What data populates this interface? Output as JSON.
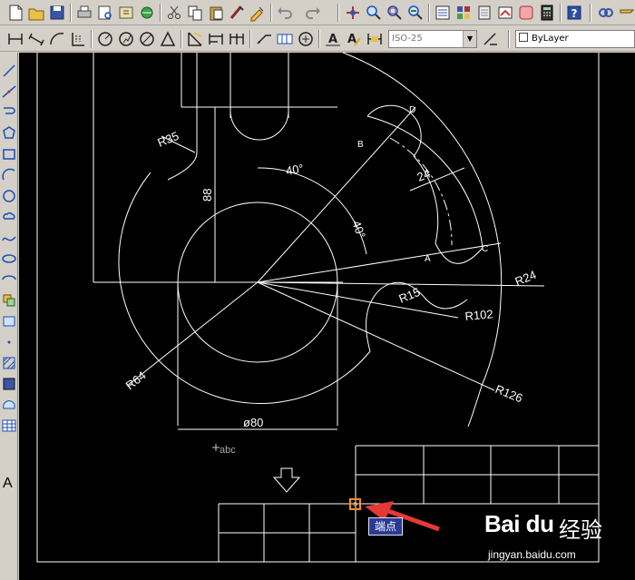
{
  "toolbar_standard": {
    "icons": [
      "new-file-icon",
      "open-file-icon",
      "save-icon",
      "print-icon",
      "print-preview-icon",
      "publish-icon",
      "plot-icon",
      "cut-icon",
      "copy-icon",
      "paste-icon",
      "match-properties-icon",
      "block-editor-icon",
      "undo-icon",
      "redo-icon",
      "pan-icon",
      "zoom-realtime-icon",
      "zoom-window-icon",
      "zoom-previous-icon",
      "properties-icon",
      "design-center-icon",
      "tool-palettes-icon",
      "markup-icon",
      "quick-calc-icon",
      "help-icon"
    ]
  },
  "toolbar_dimension": {
    "dimstyle_value": "ISO-25",
    "layer_value": "ByLayer"
  },
  "draw_toolbar": {
    "text_tool_label": "A"
  },
  "drawing": {
    "labels": {
      "r35": "R35",
      "r64": "R64",
      "r15": "R15",
      "r102": "R102",
      "r24": "R24",
      "r126": "R126",
      "dia80": "ø80",
      "d88": "88",
      "d24": "24",
      "ang1": "40°",
      "ang2": "40°",
      "pa": "A",
      "pb": "B",
      "pc": "C",
      "pd": "D",
      "cursor_text": "abc"
    }
  },
  "tooltip": {
    "label": "端点"
  },
  "watermark": {
    "logo": "Bai du",
    "brand": "经验",
    "url": "jingyan.baidu.com"
  },
  "colors": {
    "background": "#000000",
    "geometry": "#ffffff",
    "arrow": "#e53935",
    "snap_marker": "#ff8a2a",
    "tooltip_bg": "#2c3a94"
  }
}
